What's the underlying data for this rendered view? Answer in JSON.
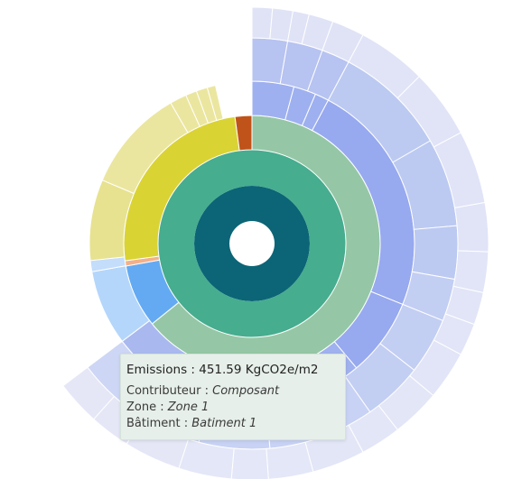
{
  "chart_data": {
    "type": "sunburst",
    "levels": [
      {
        "name": "Bâtiment",
        "segments": [
          {
            "label": "Batiment 1",
            "value": 451.59,
            "color": "#0b6576"
          }
        ]
      },
      {
        "name": "Zone",
        "segments": [
          {
            "label": "Zone 1",
            "value": 451.59,
            "color": "#46ad8f"
          }
        ]
      },
      {
        "name": "Contributeur",
        "segments": [
          {
            "label": "Composant",
            "value": 290,
            "color": "#95c7a6"
          },
          {
            "label": "",
            "value": 36,
            "color": "#63aaf3"
          },
          {
            "label": "",
            "value": 3,
            "color": "#f2b08a"
          },
          {
            "label": "",
            "value": 113,
            "color": "#dad334"
          },
          {
            "label": "",
            "value": 9.59,
            "color": "#c0531a"
          }
        ]
      }
    ]
  },
  "tooltip": {
    "title_label": "Emissions",
    "title_value": "451.59 KgCO2e/m2",
    "rows": [
      {
        "key": "Contributeur",
        "value": "Composant"
      },
      {
        "key": "Zone",
        "value": "Zone 1"
      },
      {
        "key": "Bâtiment",
        "value": "Batiment 1"
      }
    ]
  }
}
